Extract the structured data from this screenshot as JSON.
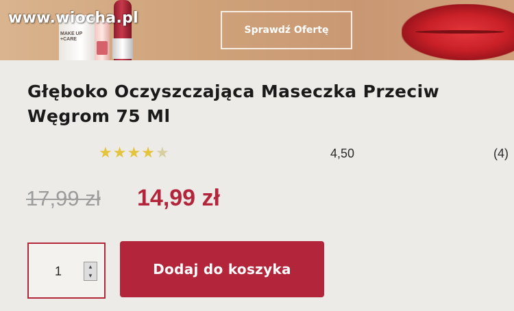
{
  "watermark": "www.wiocha.pl",
  "banner": {
    "brand_text": "MAKE UP\n+CARE",
    "offer_button": "Sprawdź Ofertę"
  },
  "product": {
    "title": "Głęboko Oczyszczająca Maseczka Przeciw Węgrom 75 Ml",
    "rating_value": "4,50",
    "rating_stars": 4.5,
    "review_count": "(4)",
    "old_price": "17,99 zł",
    "new_price": "14,99 zł"
  },
  "cart": {
    "quantity": "1",
    "add_button": "Dodaj do koszyka"
  },
  "colors": {
    "accent": "#b3253b",
    "star": "#e4c43c",
    "banner": "#cfa27a"
  },
  "icons": {
    "stepper_up": "▲",
    "stepper_down": "▼",
    "star": "★"
  }
}
